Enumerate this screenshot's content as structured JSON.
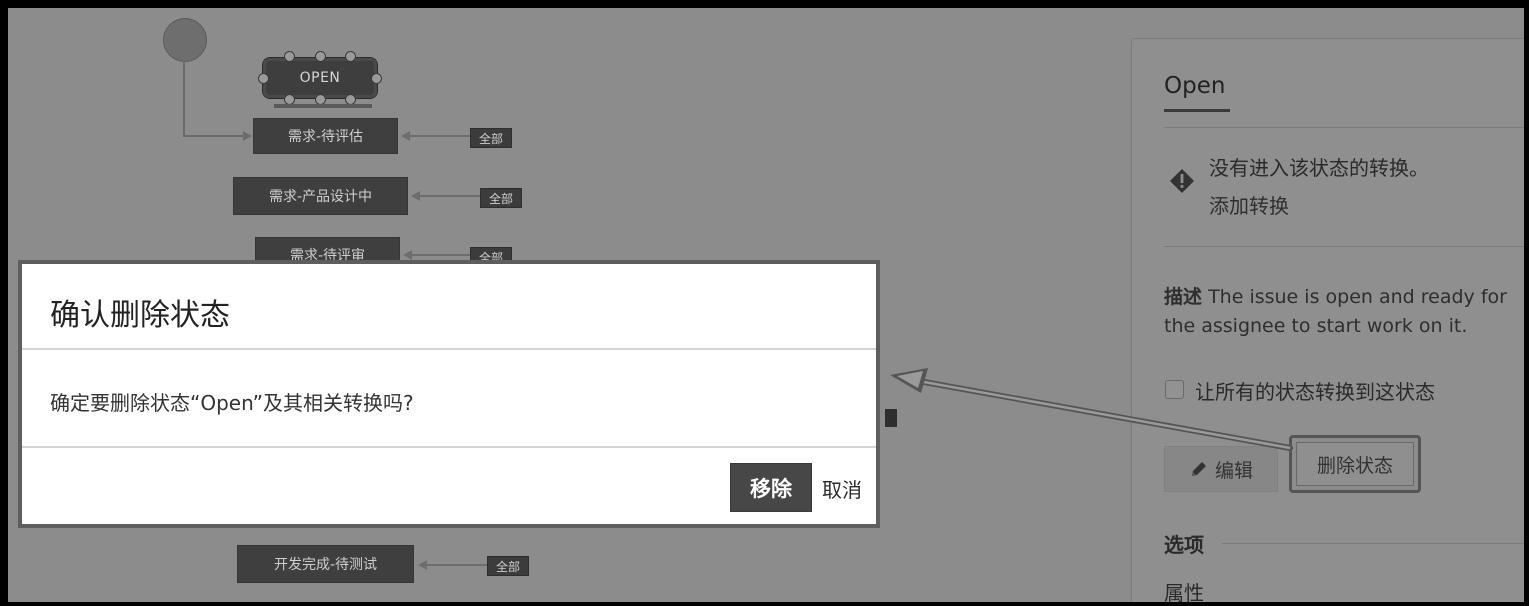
{
  "workflow": {
    "initial_state": "OPEN",
    "states": [
      {
        "label": "需求-待评估",
        "tag": "全部"
      },
      {
        "label": "需求-产品设计中",
        "tag": "全部"
      },
      {
        "label": "需求-待评审",
        "tag": "全部"
      },
      {
        "label": "开发完成-待测试",
        "tag": "全部"
      }
    ]
  },
  "panel": {
    "title": "Open",
    "no_transition_text": "没有进入该状态的转换。",
    "add_transition_link": "添加转换",
    "description_label": "描述",
    "description_line1": "The issue is open and ready for",
    "description_line2": "the assignee to start work on it.",
    "allow_all_label": "让所有的状态转换到这状态",
    "edit_button": "编辑",
    "delete_button": "删除状态",
    "options_label": "选项",
    "properties_label": "属性"
  },
  "modal": {
    "title": "确认删除状态",
    "message": "确定要删除状态“Open”及其相关转换吗?",
    "confirm_button": "移除",
    "cancel_button": "取消"
  },
  "icons": {
    "warning": "warning-diamond-icon",
    "edit": "pencil-icon"
  },
  "colors": {
    "overlay": "#8c8c8c",
    "state_fill": "#3f3f3f",
    "primary_button": "#474747",
    "modal_bg": "#ffffff"
  }
}
